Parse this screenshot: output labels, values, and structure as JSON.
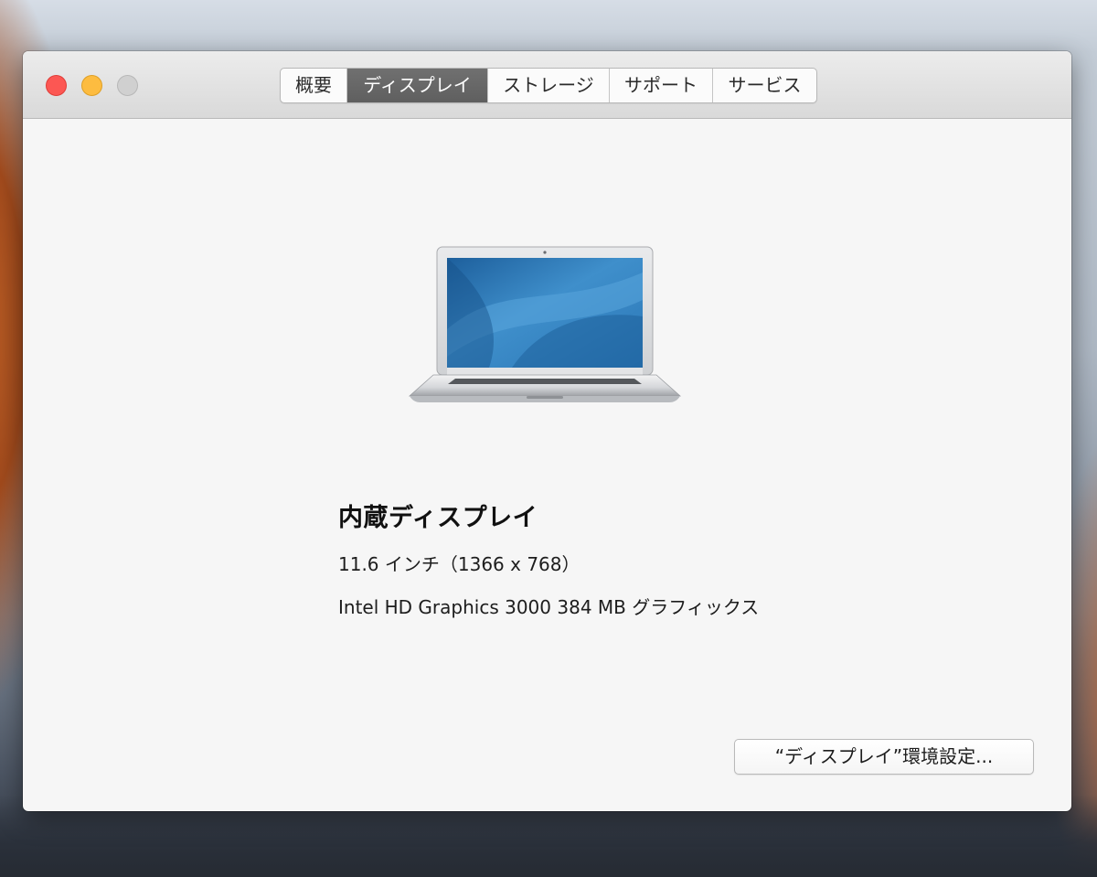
{
  "window": {
    "tabs": [
      {
        "label": "概要"
      },
      {
        "label": "ディスプレイ",
        "selected": true
      },
      {
        "label": "ストレージ"
      },
      {
        "label": "サポート"
      },
      {
        "label": "サービス"
      }
    ]
  },
  "display": {
    "name": "内蔵ディスプレイ",
    "size_resolution": "11.6 インチ（1366 x 768）",
    "graphics": "Intel HD Graphics 3000 384 MB グラフィックス"
  },
  "buttons": {
    "display_prefs": "“ディスプレイ”環境設定..."
  },
  "colors": {
    "close": "#fc5753",
    "minimize": "#fdbc40",
    "zoom_disabled": "#d0d0d0",
    "selected_tab": "#656565"
  },
  "icons": {
    "device": "macbook-air-icon"
  }
}
